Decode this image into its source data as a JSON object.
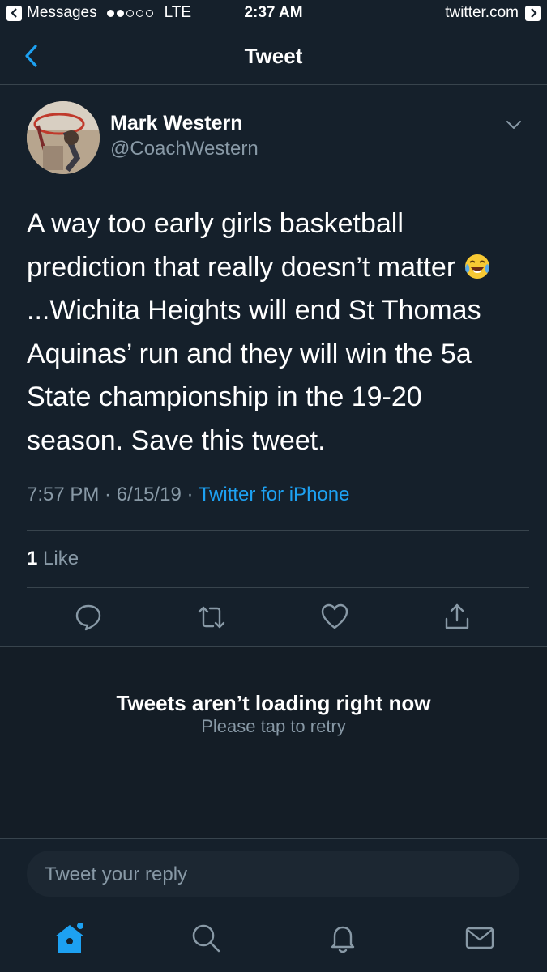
{
  "status_bar": {
    "back_app": "Messages",
    "carrier": "LTE",
    "time": "2:37 AM",
    "forward_site": "twitter.com"
  },
  "nav": {
    "title": "Tweet"
  },
  "tweet": {
    "author_name": "Mark Western",
    "author_handle": "@CoachWestern",
    "text_before_emoji": "A way too early girls basketball prediction that really doesn’t matter ",
    "text_after_emoji": "...Wichita Heights will end St Thomas Aquinas’ run and they will win the 5a State championship in the 19-20 season. Save this tweet.",
    "time": "7:57 PM",
    "date": "6/15/19",
    "source": "Twitter for iPhone",
    "like_count": "1",
    "like_label": "Like"
  },
  "error": {
    "title": "Tweets aren’t loading right now",
    "subtitle": "Please tap to retry"
  },
  "reply": {
    "placeholder": "Tweet your reply"
  },
  "colors": {
    "background": "#15202b",
    "accent": "#1da1f2",
    "secondary_text": "#8899a6",
    "divider": "#38444d"
  },
  "icons": {
    "actions": [
      "comment-icon",
      "retweet-icon",
      "like-icon",
      "share-icon"
    ],
    "tabs": [
      "home-icon",
      "search-icon",
      "notifications-icon",
      "messages-icon"
    ]
  }
}
